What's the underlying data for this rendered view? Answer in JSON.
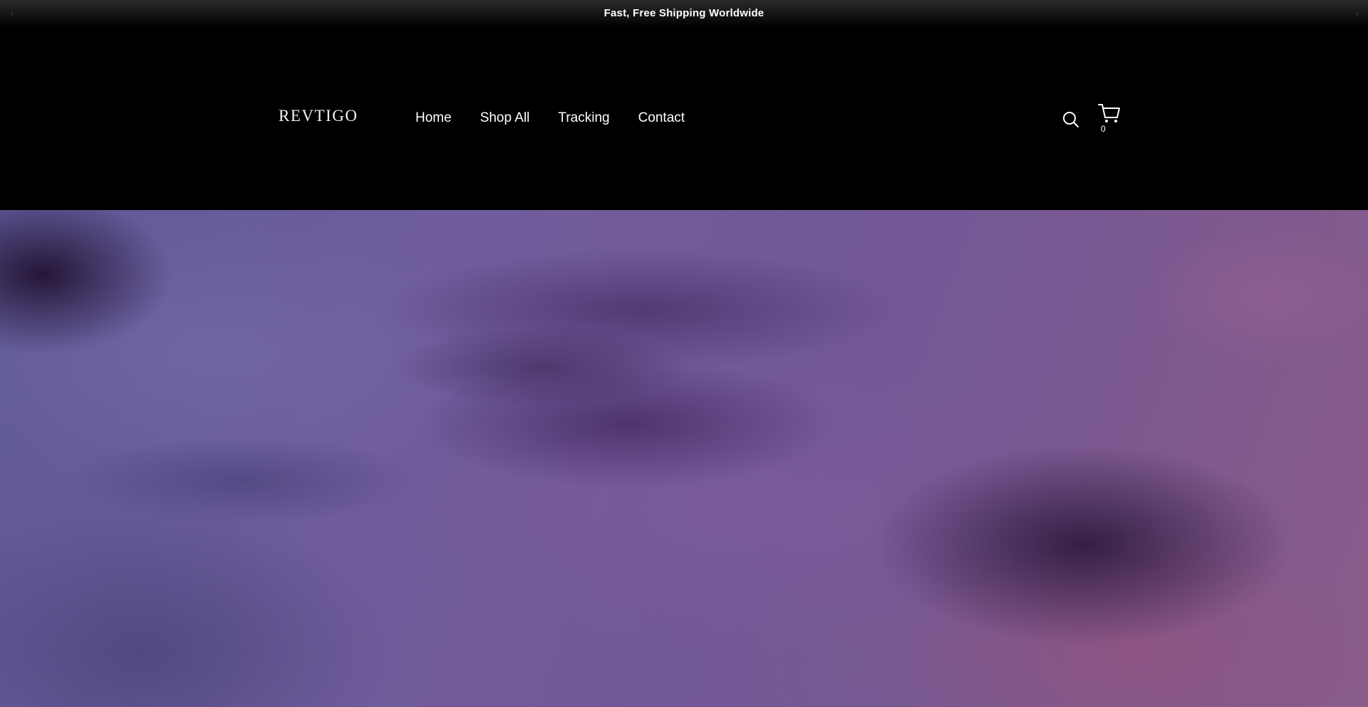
{
  "announcement": {
    "text": "Fast, Free Shipping Worldwide",
    "prev_icon": "chevron-left-icon",
    "next_icon": "chevron-right-icon"
  },
  "header": {
    "logo": "REVTIGO",
    "nav": [
      "Home",
      "Shop All",
      "Tracking",
      "Contact"
    ],
    "search_icon": "search-icon",
    "cart_icon": "cart-icon",
    "cart_count": "0"
  },
  "hero": {
    "image": "purple-abstract-hero-image"
  },
  "colors": {
    "header_bg": "#000000",
    "text": "#ffffff",
    "hero_primary": "#6f5c9c"
  }
}
